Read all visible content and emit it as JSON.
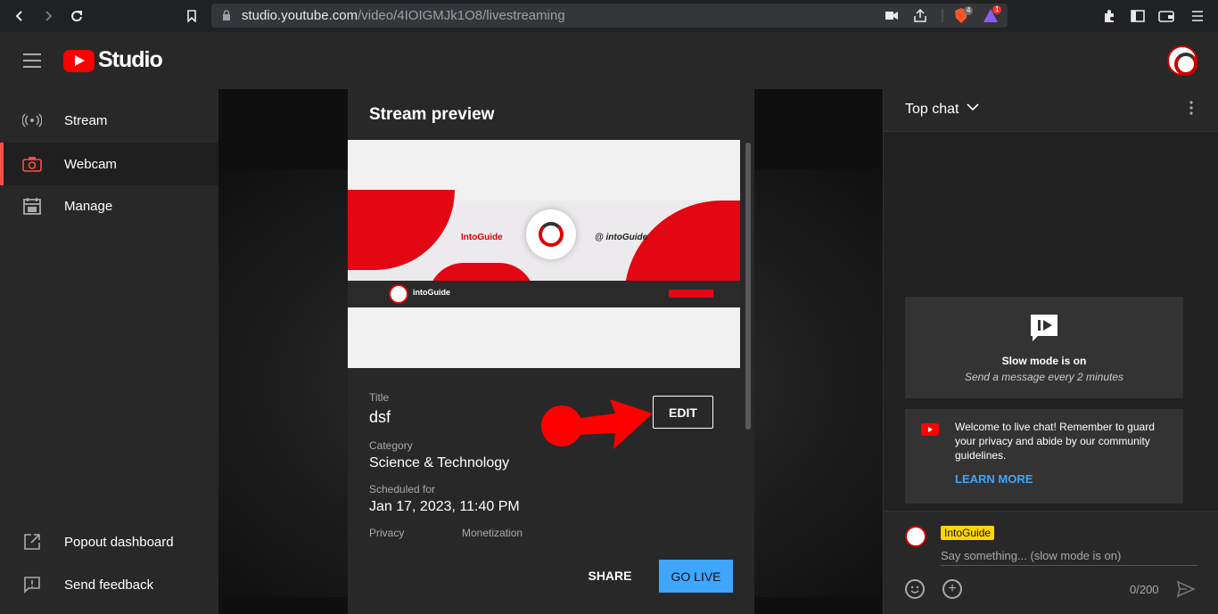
{
  "browser": {
    "url_host": "studio.youtube.com",
    "url_path": "/video/4IOIGMJk1O8/livestreaming",
    "brave_badge": "4",
    "alert_badge": "1"
  },
  "app": {
    "brand": "Studio"
  },
  "sidebar": {
    "items": [
      {
        "label": "Stream",
        "icon": "broadcast-icon"
      },
      {
        "label": "Webcam",
        "icon": "camera-icon"
      },
      {
        "label": "Manage",
        "icon": "calendar-icon"
      }
    ],
    "bottom_items": [
      {
        "label": "Popout dashboard",
        "icon": "popout-icon"
      },
      {
        "label": "Send feedback",
        "icon": "feedback-icon"
      }
    ]
  },
  "preview": {
    "title": "Stream preview",
    "thumb_brand": "IntoGuide",
    "thumb_follow": "@ intoGuide",
    "thumb_channel": "intoGuide"
  },
  "details": {
    "title_label": "Title",
    "title_value": "dsf",
    "category_label": "Category",
    "category_value": "Science & Technology",
    "scheduled_label": "Scheduled for",
    "scheduled_value": "Jan 17, 2023, 11:40 PM",
    "privacy_label": "Privacy",
    "monetization_label": "Monetization",
    "edit_label": "EDIT",
    "share_label": "SHARE",
    "golive_label": "GO LIVE"
  },
  "chat": {
    "title": "Top chat",
    "slow_title": "Slow mode is on",
    "slow_sub": "Send a message every 2 minutes",
    "welcome": "Welcome to live chat! Remember to guard your privacy and abide by our community guidelines.",
    "learn_more": "LEARN MORE",
    "author": "IntoGuide",
    "placeholder": "Say something... (slow mode is on)",
    "counter": "0/200"
  },
  "colors": {
    "accent_red": "#ff0000",
    "link_blue": "#3ea6ff",
    "author_yellow": "#ffd600"
  }
}
